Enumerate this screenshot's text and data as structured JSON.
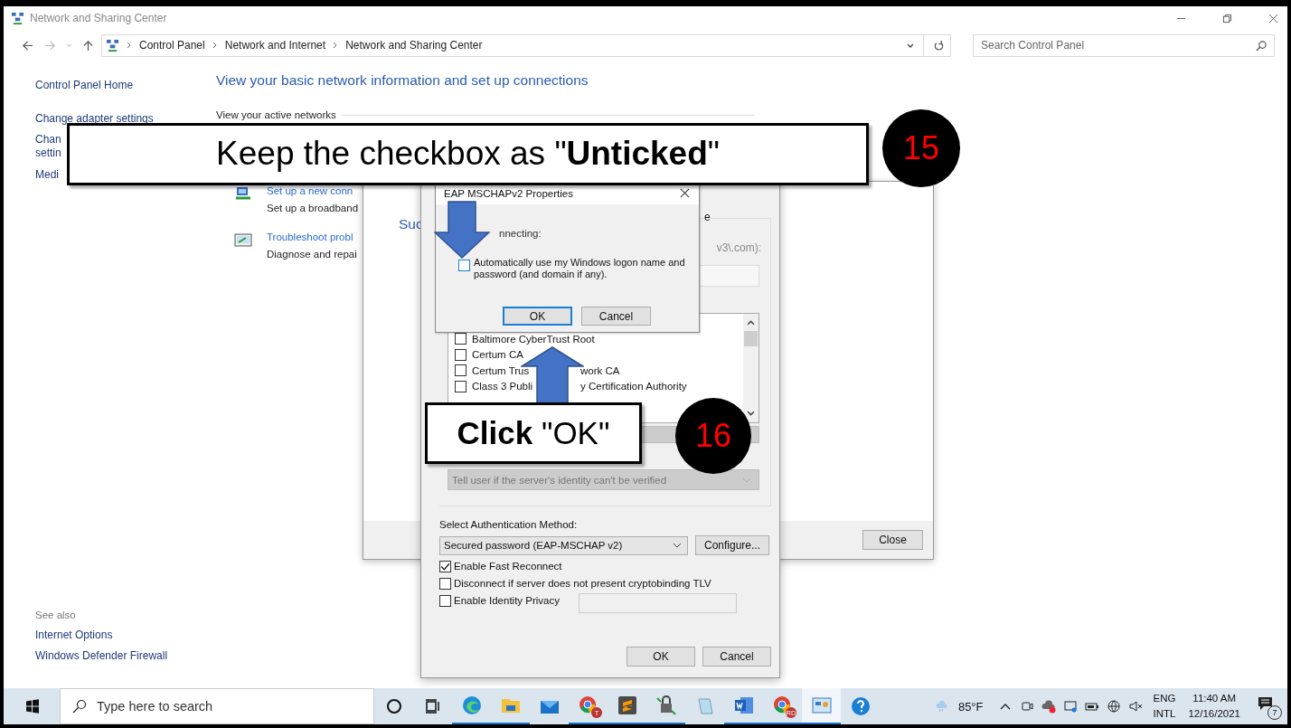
{
  "window": {
    "title": "Network and Sharing Center"
  },
  "address": {
    "breadcrumbs": [
      "Control Panel",
      "Network and Internet",
      "Network and Sharing Center"
    ],
    "search_placeholder": "Search Control Panel"
  },
  "sidebar": {
    "links": [
      "Control Panel Home",
      "Change adapter settings",
      "Chan",
      "settin",
      "Medi"
    ],
    "see_also": "See also",
    "see_also_links": [
      "Internet Options",
      "Windows Defender Firewall"
    ]
  },
  "content": {
    "heading": "View your basic network information and set up connections",
    "active_networks": "View your active networks",
    "tasks": [
      {
        "kind": "new",
        "title": "Set up a new conn",
        "description": "Set up a broadband"
      },
      {
        "kind": "trouble",
        "title": "Troubleshoot probl",
        "description": "Diagnose and repai"
      }
    ]
  },
  "background_dialog": {
    "title": "Suc",
    "close": "Close"
  },
  "peap_dialog": {
    "heading_tail": "e",
    "server_hint": "v3\\.com):",
    "certificates": [
      {
        "parts": [
          "Baltimore CyberTrust Root"
        ],
        "checked": false
      },
      {
        "parts": [
          "Certum CA"
        ],
        "checked": false
      },
      {
        "parts": [
          "Certum Trus",
          "work CA"
        ],
        "checked": false
      },
      {
        "parts": [
          "Class 3 Publi",
          "y Certification Authority"
        ],
        "checked": false
      }
    ],
    "notification": "Tell user if the server's identity can't be verified",
    "auth_label": "Select Authentication Method:",
    "auth_method": "Secured password (EAP-MSCHAP v2)",
    "configure": "Configure...",
    "options": [
      {
        "label": "Enable Fast Reconnect",
        "checked": true
      },
      {
        "label": "Disconnect if server does not present cryptobinding TLV",
        "checked": false
      },
      {
        "label": "Enable Identity Privacy",
        "checked": false
      }
    ],
    "ok": "OK",
    "cancel": "Cancel"
  },
  "mschap_dialog": {
    "title": "EAP MSCHAPv2 Properties",
    "prompt": "nnecting:",
    "option": {
      "label": "Automatically use my Windows logon name and password (and domain if any).",
      "checked": false
    },
    "ok": "OK",
    "cancel": "Cancel"
  },
  "callouts": [
    {
      "text": "Keep the checkbox as \"**Unticked**\"",
      "number": "15"
    },
    {
      "text": "**Click** \"OK\"",
      "number": "16"
    }
  ],
  "taskbar": {
    "search_placeholder": "Type here to search",
    "apps": [
      {
        "kind": "cortana",
        "running": false,
        "selected": false
      },
      {
        "kind": "taskview",
        "running": false,
        "selected": false
      },
      {
        "kind": "edge",
        "running": true,
        "selected": false
      },
      {
        "kind": "explorer",
        "running": true,
        "selected": false
      },
      {
        "kind": "mail",
        "running": false,
        "selected": false
      },
      {
        "kind": "chrome",
        "badge": "T",
        "running": true,
        "selected": false
      },
      {
        "kind": "sublime",
        "running": true,
        "selected": false
      },
      {
        "kind": "vpn",
        "running": true,
        "selected": false
      },
      {
        "kind": "notepad",
        "running": false,
        "selected": false
      },
      {
        "kind": "word",
        "running": true,
        "selected": false
      },
      {
        "kind": "chrome",
        "badge": "RD",
        "running": true,
        "selected": false
      },
      {
        "kind": "controlpanel",
        "running": true,
        "selected": true
      },
      {
        "kind": "help",
        "running": false,
        "selected": false
      }
    ],
    "weather": "85°F",
    "language": [
      "ENG",
      "INTL"
    ],
    "time": "11:40 AM",
    "date": "12/16/2021",
    "notifications": "7"
  }
}
